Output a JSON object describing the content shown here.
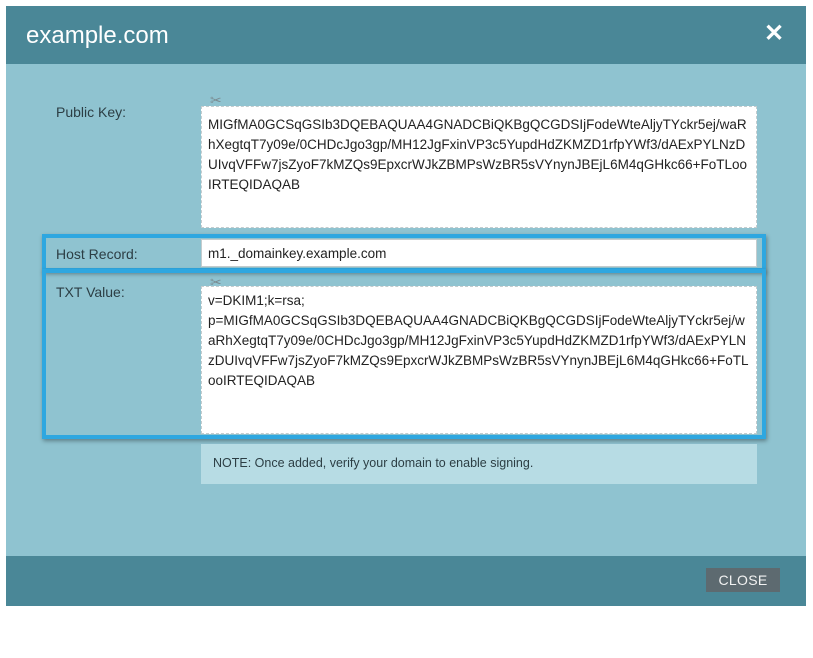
{
  "dialog": {
    "title": "example.com",
    "close_icon": "close-icon"
  },
  "fields": {
    "public_key": {
      "label": "Public Key:",
      "value": "MIGfMA0GCSqGSIb3DQEBAQUAA4GNADCBiQKBgQCGDSIjFodeWteAljyTYckr5ej/waRhXegtqT7y09e/0CHDcJgo3gp/MH12JgFxinVP3c5YupdHdZKMZD1rfpYWf3/dAExPYLNzDUIvqVFFw7jsZyoF7kMZQs9EpxcrWJkZBMPsWzBR5sVYnynJBEjL6M4qGHkc66+FoTLooIRTEQIDAQAB"
    },
    "host_record": {
      "label": "Host Record:",
      "value": "m1._domainkey.example.com"
    },
    "txt_value": {
      "label": "TXT Value:",
      "value": "v=DKIM1;k=rsa;\np=MIGfMA0GCSqGSIb3DQEBAQUAA4GNADCBiQKBgQCGDSIjFodeWteAljyTYckr5ej/waRhXegtqT7y09e/0CHDcJgo3gp/MH12JgFxinVP3c5YupdHdZKMZD1rfpYWf3/dAExPYLNzDUIvqVFFw7jsZyoF7kMZQs9EpxcrWJkZBMPsWzBR5sVYnynJBEjL6M4qGHkc66+FoTLooIRTEQIDAQAB"
    }
  },
  "note": {
    "text": "NOTE:  Once added, verify your domain to enable signing."
  },
  "footer": {
    "close_label": "CLOSE"
  },
  "colors": {
    "header": "#4a8797",
    "body": "#8fc3d0",
    "highlight": "#2ea7e0",
    "close_button": "#5d6a70"
  }
}
